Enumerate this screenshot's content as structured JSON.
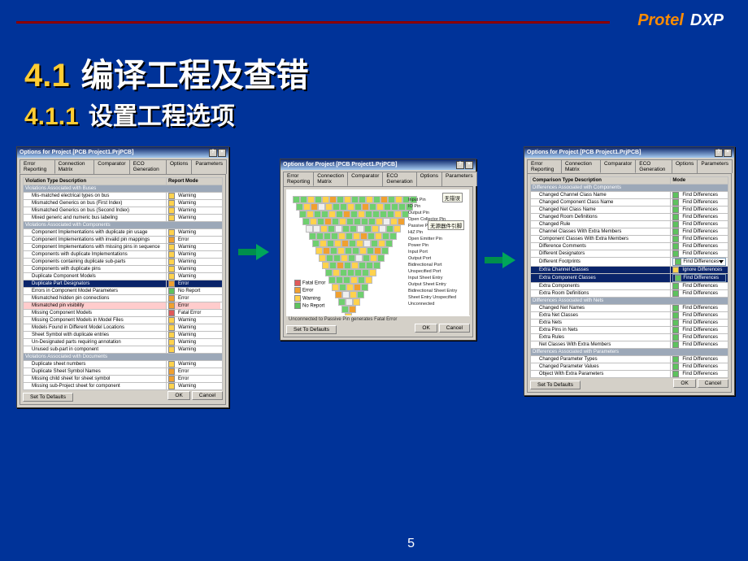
{
  "brand": {
    "p": "Protel",
    "d": "DXP"
  },
  "heading1": {
    "num": "4.1",
    "text": "编译工程及查错"
  },
  "heading2": {
    "num": "4.1.1",
    "text": "设置工程选项"
  },
  "slide_number": "5",
  "dlg1": {
    "title": "Options for Project [PCB Project1.PrjPCB]",
    "tabs": [
      "Error Reporting",
      "Connection Matrix",
      "Comparator",
      "ECO Generation",
      "Options",
      "Parameters"
    ],
    "active_tab": 0,
    "columns": [
      "Violation Type Description",
      "Report Mode"
    ],
    "groups": [
      {
        "name": "Violations Associated with Buses",
        "rows": [
          [
            "Mis-matched electrical types on bus",
            "Warning"
          ],
          [
            "Mismatched Generics on bus (First Index)",
            "Warning"
          ],
          [
            "Mismatched Generics on bus (Second Index)",
            "Warning"
          ],
          [
            "Mixed generic and numeric bus labeling",
            "Warning"
          ]
        ]
      },
      {
        "name": "Violations Associated with Components",
        "rows": [
          [
            "Component Implementations with duplicate pin usage",
            "Warning"
          ],
          [
            "Component Implementations with invalid pin mappings",
            "Error"
          ],
          [
            "Component Implementations with missing pins in sequence",
            "Warning"
          ],
          [
            "Components with duplicate Implementations",
            "Warning"
          ],
          [
            "Components containing duplicate sub-parts",
            "Warning"
          ],
          [
            "Components with duplicate pins",
            "Warning"
          ],
          [
            "Duplicate Component Models",
            "Warning"
          ],
          [
            "Duplicate Part Designators",
            "Error",
            "selected"
          ],
          [
            "Errors in Component Model Parameters",
            "No Report"
          ],
          [
            "Mismatched hidden pin connections",
            "Error"
          ],
          [
            "Mismatched pin visibility",
            "Error",
            "hl-error"
          ],
          [
            "Missing Component Models",
            "Fatal Error"
          ],
          [
            "Missing Component Models in Model Files",
            "Warning"
          ],
          [
            "Models Found in Different Model Locations",
            "Warning"
          ],
          [
            "Sheet Symbol with duplicate entries",
            "Warning"
          ],
          [
            "Un-Designated parts requiring annotation",
            "Warning"
          ],
          [
            "Unused sub-part in component",
            "Warning"
          ]
        ]
      },
      {
        "name": "Violations Associated with Documents",
        "rows": [
          [
            "Duplicate sheet numbers",
            "Warning"
          ],
          [
            "Duplicate Sheet Symbol Names",
            "Error"
          ],
          [
            "Missing child sheet for sheet symbol",
            "Error"
          ],
          [
            "Missing sub-Project sheet for component",
            "Warning"
          ]
        ]
      }
    ],
    "footer": {
      "defaults": "Set To Defaults",
      "ok": "OK",
      "cancel": "Cancel"
    }
  },
  "dlg2": {
    "title": "Options for Project [PCB Project1.PrjPCB]",
    "tabs": [
      "Error Reporting",
      "Connection Matrix",
      "Comparator",
      "ECO Generation",
      "Options",
      "Parameters"
    ],
    "active_tab": 1,
    "annotations": {
      "a1": "无错误",
      "a2": "无源器件引脚"
    },
    "right_labels": [
      "Input Pin",
      "IO Pin",
      "Output Pin",
      "Open Collector Pin",
      "Passive Pin",
      "HiZ Pin",
      "Open Emitter Pin",
      "Power Pin",
      "Input Port",
      "Output Port",
      "Bidirectional Port",
      "Unspecified Port",
      "Input Sheet Entry",
      "Output Sheet Entry",
      "Bidirectional Sheet Entry",
      "Sheet Entry Unspecified",
      "Unconnected"
    ],
    "legend": [
      [
        "Fatal Error",
        "r"
      ],
      [
        "Error",
        "o"
      ],
      [
        "Warning",
        "y"
      ],
      [
        "No Report",
        "g"
      ]
    ],
    "status": "Unconnected to Passive Pin generates Fatal Error",
    "footer": {
      "defaults": "Set To Defaults",
      "ok": "OK",
      "cancel": "Cancel"
    }
  },
  "dlg3": {
    "title": "Options for Project [PCB Project1.PrjPCB]",
    "tabs": [
      "Error Reporting",
      "Connection Matrix",
      "Comparator",
      "ECO Generation",
      "Options",
      "Parameters"
    ],
    "active_tab": 2,
    "columns": [
      "Comparison Type Description",
      "Mode"
    ],
    "groups": [
      {
        "name": "Differences Associated with Components",
        "rows": [
          [
            "Changed Channel Class Name",
            "Find Differences"
          ],
          [
            "Changed Component Class Name",
            "Find Differences"
          ],
          [
            "Changed Net Class Name",
            "Find Differences"
          ],
          [
            "Changed Room Definitions",
            "Find Differences"
          ],
          [
            "Changed Rule",
            "Find Differences"
          ],
          [
            "Channel Classes With Extra Members",
            "Find Differences"
          ],
          [
            "Component Classes With Extra Members",
            "Find Differences"
          ],
          [
            "Difference Comments",
            "Find Differences"
          ],
          [
            "Different Designators",
            "Find Differences"
          ],
          [
            "Different Footprints",
            "Find Differences",
            "drop"
          ],
          [
            "Extra Channel Classes",
            "Ignore Differences",
            "selected"
          ],
          [
            "Extra Component Classes",
            "Find Differences",
            "selected-hl"
          ],
          [
            "Extra Components",
            "Find Differences"
          ],
          [
            "Extra Room Definitions",
            "Find Differences"
          ]
        ]
      },
      {
        "name": "Differences Associated with Nets",
        "rows": [
          [
            "Changed Net Names",
            "Find Differences"
          ],
          [
            "Extra Net Classes",
            "Find Differences"
          ],
          [
            "Extra Nets",
            "Find Differences"
          ],
          [
            "Extra Pins in Nets",
            "Find Differences"
          ],
          [
            "Extra Rules",
            "Find Differences"
          ],
          [
            "Net Classes With Extra Members",
            "Find Differences"
          ]
        ]
      },
      {
        "name": "Differences Associated with Parameters",
        "rows": [
          [
            "Changed Parameter Types",
            "Find Differences"
          ],
          [
            "Changed Parameter Values",
            "Find Differences"
          ],
          [
            "Object With Extra Parameters",
            "Find Differences"
          ]
        ]
      }
    ],
    "footer": {
      "defaults": "Set To Defaults",
      "ok": "OK",
      "cancel": "Cancel"
    }
  }
}
